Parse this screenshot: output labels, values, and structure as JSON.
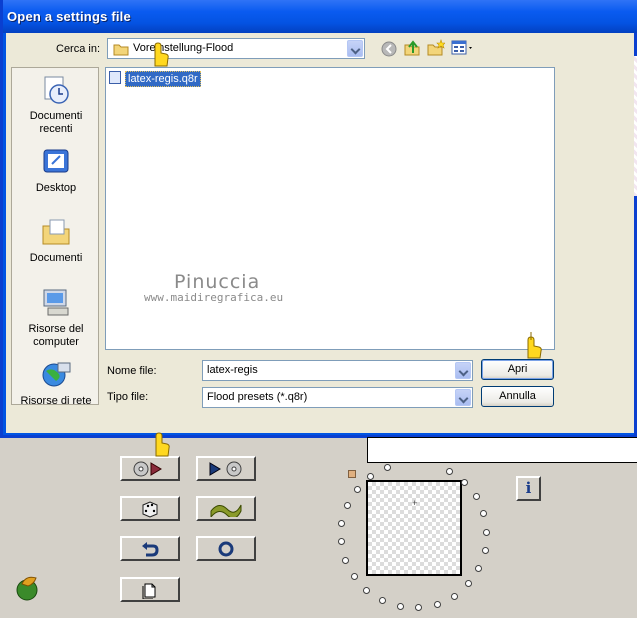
{
  "dialog": {
    "title": "Open a settings file",
    "look_in_label": "Cerca in:",
    "look_in_value": "Voreinstellung-Flood",
    "file_name_label": "Nome file:",
    "file_name_value": "latex-regis",
    "file_type_label": "Tipo file:",
    "file_type_value": "Flood presets (*.q8r)",
    "open_button": "Apri",
    "cancel_button": "Annulla",
    "files": [
      "latex-regis.q8r"
    ],
    "places": [
      {
        "label": "Documenti recenti",
        "icon": "recent-documents-icon"
      },
      {
        "label": "Desktop",
        "icon": "desktop-icon"
      },
      {
        "label": "Documenti",
        "icon": "my-documents-icon"
      },
      {
        "label": "Risorse del computer",
        "icon": "my-computer-icon"
      },
      {
        "label": "Risorse di rete",
        "icon": "network-icon"
      }
    ]
  },
  "watermark": {
    "name": "Pinuccia",
    "site": "www.maidiregrafica.eu"
  },
  "plugin": {
    "buttons": [
      {
        "name": "load-preset-button",
        "icon": "disc-load-icon"
      },
      {
        "name": "save-preset-button",
        "icon": "disc-save-icon"
      },
      {
        "name": "randomize-button",
        "icon": "dice-icon"
      },
      {
        "name": "wave-button",
        "icon": "wave-icon"
      },
      {
        "name": "undo-button",
        "icon": "undo-icon"
      },
      {
        "name": "reset-button",
        "icon": "ring-icon"
      },
      {
        "name": "copy-button",
        "icon": "copy-icon"
      }
    ],
    "info_label": "i"
  },
  "colors": {
    "titlebar": "#0453e2",
    "dialog_bg": "#ece9d8",
    "selection": "#316ac5",
    "plugin_bg": "#d4d0c8"
  }
}
